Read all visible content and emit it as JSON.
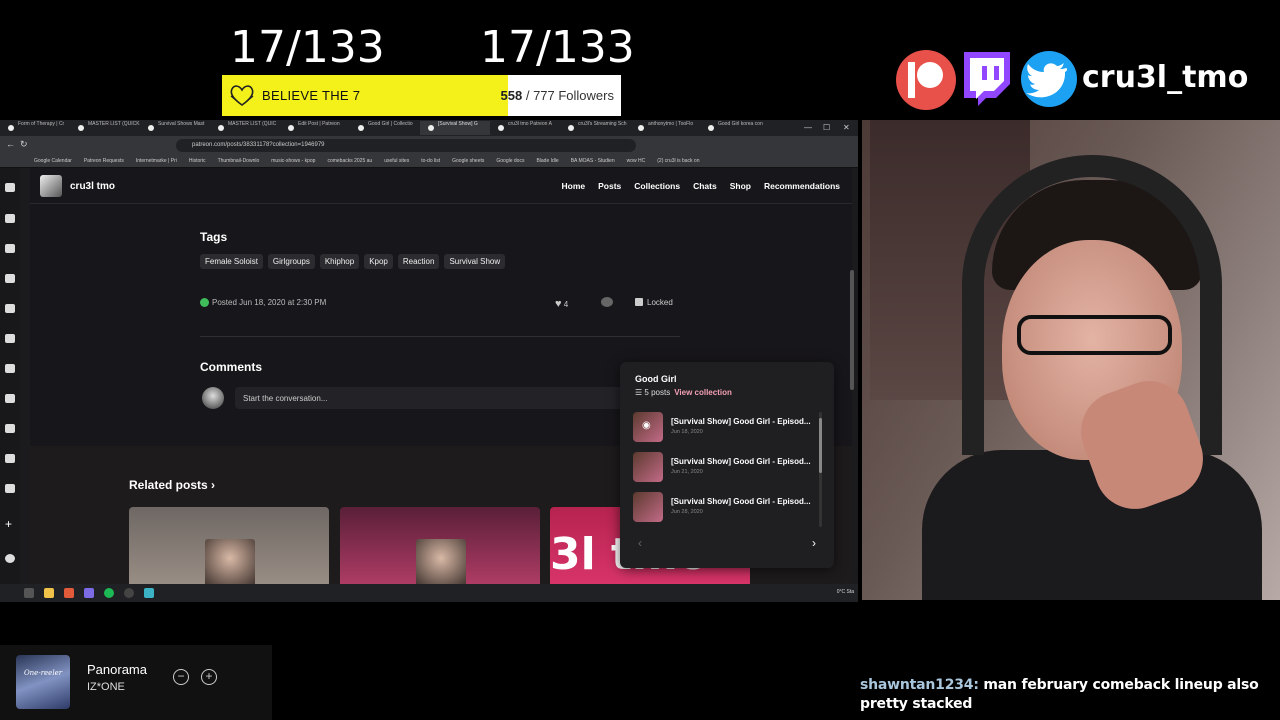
{
  "overlay": {
    "counter_left": "17/133",
    "counter_right": "17/133",
    "follower_goal": {
      "label": "BELIEVE THE 7",
      "current": "558",
      "separator": " / ",
      "target_text": "777 Followers",
      "progress_fraction": 0.718
    },
    "social_handle": "cru3l_tmo",
    "colors": {
      "bar_fill": "#f3f01a",
      "patreon": "#e8504a",
      "twitch": "#9146ff",
      "twitter": "#1da1f2"
    }
  },
  "browser": {
    "tabs": [
      "Form of Therapy | Cr",
      "MASTER LIST (QUICK",
      "Survival Shows Mast",
      "MASTER LIST (QUIC",
      "Edit Post | Patreon",
      "Good Girl | Collectio",
      "[Survival Show] G",
      "cru3l tmo Patreon A",
      "cru3l's Streaming Sch",
      "anthonytmo | TooFlo",
      "Good Girl korea con"
    ],
    "active_tab_index": 6,
    "url": "patreon.com/posts/38331178?collection=1946979",
    "bookmarks": [
      "Google Calendar",
      "Patreon Requests",
      "Internetmarke | Pri",
      "Historic",
      "Thumbnail-Downlo",
      "music-shows - kpop",
      "comebacks 2025 au",
      "useful sites",
      "to-do list",
      "Google sheets",
      "Google docs",
      "Blade Idle",
      "BA MOAS - Studien",
      "wow HC",
      "(2) cru3l is back on"
    ]
  },
  "site": {
    "name": "cru3l tmo",
    "nav": [
      "Home",
      "Posts",
      "Collections",
      "Chats",
      "Shop",
      "Recommendations"
    ],
    "tags_title": "Tags",
    "tags": [
      "Female Soloist",
      "Girlgroups",
      "Khiphop",
      "Kpop",
      "Reaction",
      "Survival Show"
    ],
    "posted": "Posted Jun 18, 2020 at 2:30 PM",
    "likes": "4",
    "locked_label": "Locked",
    "comments_title": "Comments",
    "comment_placeholder": "Start the conversation...",
    "related_title": "Related posts",
    "related_logo_text": "3l tmo"
  },
  "collection": {
    "title": "Good Girl",
    "count": "5 posts",
    "view_label": "View collection",
    "items": [
      {
        "name": "[Survival Show] Good Girl - Episod...",
        "date": "Jun 18, 2020"
      },
      {
        "name": "[Survival Show] Good Girl - Episod...",
        "date": "Jun 21, 2020"
      },
      {
        "name": "[Survival Show] Good Girl - Episod...",
        "date": "Jun 28, 2020"
      }
    ]
  },
  "taskbar": {
    "tray": "0°C Sta"
  },
  "now_playing": {
    "title": "Panorama",
    "artist": "IZ*ONE",
    "album_art_text": "One-reeler"
  },
  "chat": {
    "user": "shawntan1234:",
    "message": "man february comeback lineup also pretty stacked"
  }
}
